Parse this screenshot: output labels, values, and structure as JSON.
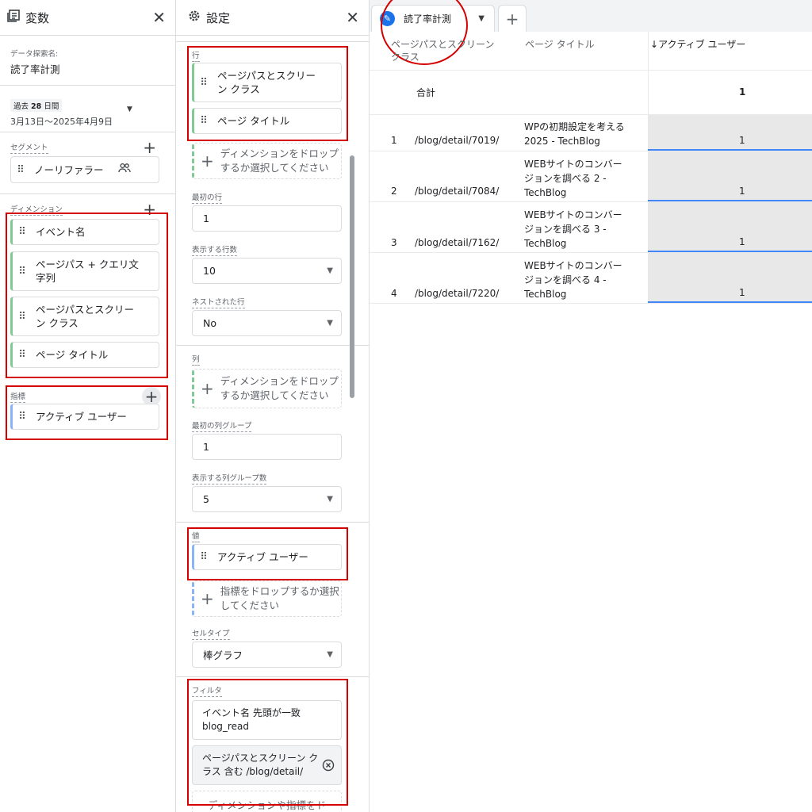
{
  "variables": {
    "title": "変数",
    "name_label": "データ探索名:",
    "name_value": "読了率計測",
    "date": {
      "badge_prefix": "過去",
      "badge_days": "28",
      "badge_suffix": "日間",
      "range": "3月13日～2025年4月9日"
    },
    "segments": {
      "label": "セグメント",
      "items": [
        "ノーリファラー"
      ]
    },
    "dimensions": {
      "label": "ディメンション",
      "items": [
        "イベント名",
        "ページパス + クエリ文字列",
        "ページパスとスクリーン クラス",
        "ページ タイトル"
      ]
    },
    "metrics": {
      "label": "指標",
      "items": [
        "アクティブ ユーザー"
      ]
    }
  },
  "settings": {
    "title": "設定",
    "rows": {
      "label": "行",
      "items": [
        "ページパスとスクリーン クラス",
        "ページ タイトル"
      ],
      "drop_text": "ディメンションをドロップするか選択してください"
    },
    "first_row": {
      "label": "最初の行",
      "value": "1"
    },
    "rows_shown": {
      "label": "表示する行数",
      "value": "10"
    },
    "nested_rows": {
      "label": "ネストされた行",
      "value": "No"
    },
    "columns": {
      "label": "列",
      "drop_text": "ディメンションをドロップするか選択してください"
    },
    "first_col_group": {
      "label": "最初の列グループ",
      "value": "1"
    },
    "col_groups_shown": {
      "label": "表示する列グループ数",
      "value": "5"
    },
    "values": {
      "label": "値",
      "items": [
        "アクティブ ユーザー"
      ],
      "drop_text": "指標をドロップするか選択してください"
    },
    "cell_type": {
      "label": "セルタイプ",
      "value": "棒グラフ"
    },
    "filters": {
      "label": "フィルタ",
      "items": [
        {
          "line1": "イベント名 先頭が一致",
          "line2": "blog_read"
        },
        {
          "line1": "ページパスとスクリーン ク",
          "line2": "ラス 含む /blog/detail/"
        }
      ],
      "drop_text": "ディメンションや指標をド"
    }
  },
  "tabs": [
    {
      "label": "読了率計測"
    }
  ],
  "table": {
    "headers": {
      "col1": "ページパスとスクリーン クラス",
      "col2": "ページ タイトル",
      "col3": "アクティブ ユーザー"
    },
    "total": {
      "label": "合計",
      "value": "1"
    },
    "rows": [
      {
        "index": "1",
        "path": "/blog/detail/7019/",
        "title": "WPの初期設定を考える2025 - TechBlog",
        "value": "1"
      },
      {
        "index": "2",
        "path": "/blog/detail/7084/",
        "title": "WEBサイトのコンバージョンを調べる 2 - TechBlog",
        "value": "1"
      },
      {
        "index": "3",
        "path": "/blog/detail/7162/",
        "title": "WEBサイトのコンバージョンを調べる 3 - TechBlog",
        "value": "1"
      },
      {
        "index": "4",
        "path": "/blog/detail/7220/",
        "title": "WEBサイトのコンバージョンを調べる 4 - TechBlog",
        "value": "1"
      }
    ]
  },
  "colors": {
    "highlight_red": "#d50000",
    "dimension_green": "#81c995",
    "metric_blue": "#8ab4f8",
    "bar_blue": "#4285f4",
    "accent": "#1a73e8"
  },
  "icons": [
    "variables-icon",
    "close-icon",
    "gear-icon",
    "people-icon",
    "cancel-circle-icon",
    "pencil-icon",
    "dropdown-arrow-icon",
    "add-icon",
    "drag-handle-icon",
    "sort-down-icon"
  ]
}
